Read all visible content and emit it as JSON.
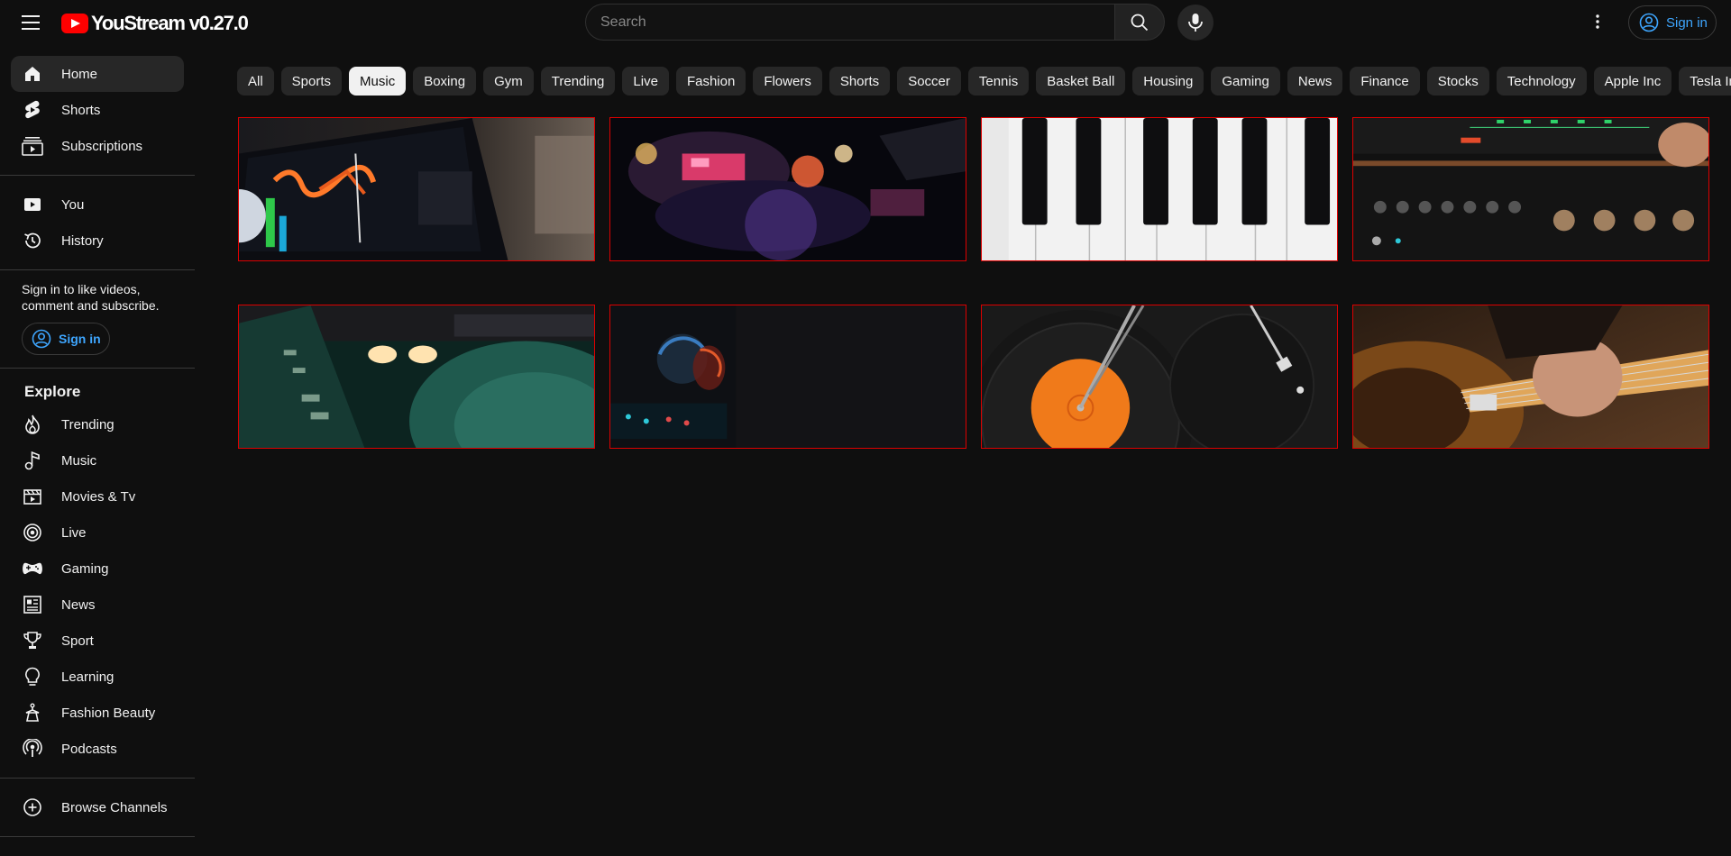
{
  "app": {
    "name": "YouStream v0.27.0"
  },
  "header": {
    "search_placeholder": "Search",
    "signin_label": "Sign in",
    "icons": [
      "menu-icon",
      "search-icon",
      "mic-icon",
      "more-vert-icon",
      "account-circle-icon"
    ]
  },
  "sidebar": {
    "main": [
      {
        "label": "Home",
        "icon": "home-icon",
        "active": true
      },
      {
        "label": "Shorts",
        "icon": "shorts-icon"
      },
      {
        "label": "Subscriptions",
        "icon": "subscriptions-icon"
      }
    ],
    "you": [
      {
        "label": "You",
        "icon": "you-icon"
      },
      {
        "label": "History",
        "icon": "history-icon"
      }
    ],
    "signin_note": "Sign in to like videos, comment and subscribe.",
    "signin_label": "Sign in",
    "explore_title": "Explore",
    "explore": [
      {
        "label": "Trending",
        "icon": "trending-icon"
      },
      {
        "label": "Music",
        "icon": "music-icon"
      },
      {
        "label": "Movies & Tv",
        "icon": "movies-icon"
      },
      {
        "label": "Live",
        "icon": "live-icon"
      },
      {
        "label": "Gaming",
        "icon": "gaming-icon"
      },
      {
        "label": "News",
        "icon": "news-icon"
      },
      {
        "label": "Sport",
        "icon": "sport-icon"
      },
      {
        "label": "Learning",
        "icon": "learning-icon"
      },
      {
        "label": "Fashion Beauty",
        "icon": "fashion-icon"
      },
      {
        "label": "Podcasts",
        "icon": "podcasts-icon"
      }
    ],
    "browse_label": "Browse Channels"
  },
  "chips": [
    "All",
    "Sports",
    "Music",
    "Boxing",
    "Gym",
    "Trending",
    "Live",
    "Fashion",
    "Flowers",
    "Shorts",
    "Soccer",
    "Tennis",
    "Basket Ball",
    "Housing",
    "Gaming",
    "News",
    "Finance",
    "Stocks",
    "Technology",
    "Apple Inc",
    "Tesla Inc"
  ],
  "active_chip": "Music",
  "videos": [
    {
      "thumb": "dj-laptop"
    },
    {
      "thumb": "concert-aerial"
    },
    {
      "thumb": "piano-keys"
    },
    {
      "thumb": "stereo-receiver"
    },
    {
      "thumb": "dj-deck-green"
    },
    {
      "thumb": "dj-knobs-dark"
    },
    {
      "thumb": "vinyl-turntable"
    },
    {
      "thumb": "electric-guitar"
    }
  ],
  "colors": {
    "background": "#0f0f0f",
    "accent": "#ff0000",
    "link": "#3ea6ff",
    "chip": "#272727"
  }
}
